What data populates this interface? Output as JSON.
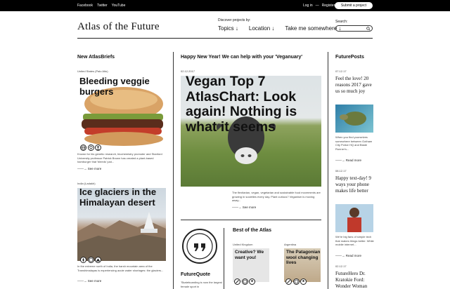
{
  "topbar": {
    "social": [
      "Facebook",
      "Twitter",
      "YouTube"
    ],
    "login": "Log in",
    "sep": "—",
    "register": "Register",
    "submit": "Submit a project"
  },
  "header": {
    "logo": "Atlas of the Future",
    "discover": "Discover projects by:",
    "nav": [
      "Topics ↓",
      "Location ↓",
      "Take me somewhere ↓"
    ],
    "search_label": "Search:"
  },
  "icons": [
    "search-icon",
    "globe-icon",
    "arrow-icon"
  ],
  "colors": {
    "topbar": "#000000",
    "text": "#111111"
  },
  "briefs": {
    "title": "New AtlasBriefs",
    "items": [
      {
        "location": "United States (Palo Alto)",
        "headline": "Bleeding veggie burgers",
        "caption": "Known for his genetic research, biochemistry promoter and Stanford University professor Patrick Brown has created a plant-based hamburger that 'bleeds' just...",
        "see_more": "——→ See more"
      },
      {
        "location": "India (Ladakh)",
        "headline": "Ice glaciers in the Himalayan desert",
        "caption": "In the extreme north of India, the harsh mountain area of the Transhimalayas is experiencing acute water shortages: the glaciers...",
        "see_more": "——→ See more"
      }
    ]
  },
  "feature": {
    "title": "Happy New Year! We can help with your 'Veganuary'",
    "date": "02.12.2017",
    "headline": "Vegan Top 7 AtlasChart: Look again! Nothing is what it seems",
    "caption": "The flexitarian, vegan, vegetarian and sustainable food movements are growing in societies every day. Plant curious? Veganism is moving away...",
    "see_more": "——→ See more"
  },
  "quote": {
    "title": "FutureQuote",
    "caption": "'Skateboarding is now the largest female sport in"
  },
  "best": {
    "title": "Best of the Atlas",
    "cards": [
      {
        "location": "United Kingdom",
        "headline": "Creative? We want you!"
      },
      {
        "location": "Argentina",
        "headline": "The Patagonian wool changing lives"
      }
    ]
  },
  "posts": {
    "title": "FuturePosts",
    "items": [
      {
        "date": "07.12.17",
        "headline": "Feel the love! 20 reasons 2017 gave us so much joy",
        "caption": "When you find yourselves somewhere between Gotham City Police HQ and Blade Runner's...",
        "read_more": "——→ Read more"
      },
      {
        "date": "08.12.17",
        "headline": "Happy text-day! 9 ways your phone makes life better",
        "caption": "We're big fans of simple tech that makes things better. While mobile internet...",
        "read_more": "——→ Read more"
      },
      {
        "date": "02.12.17",
        "headline": "FutureHero Dr. Kratokie Ford: Wonder Woman"
      }
    ]
  }
}
